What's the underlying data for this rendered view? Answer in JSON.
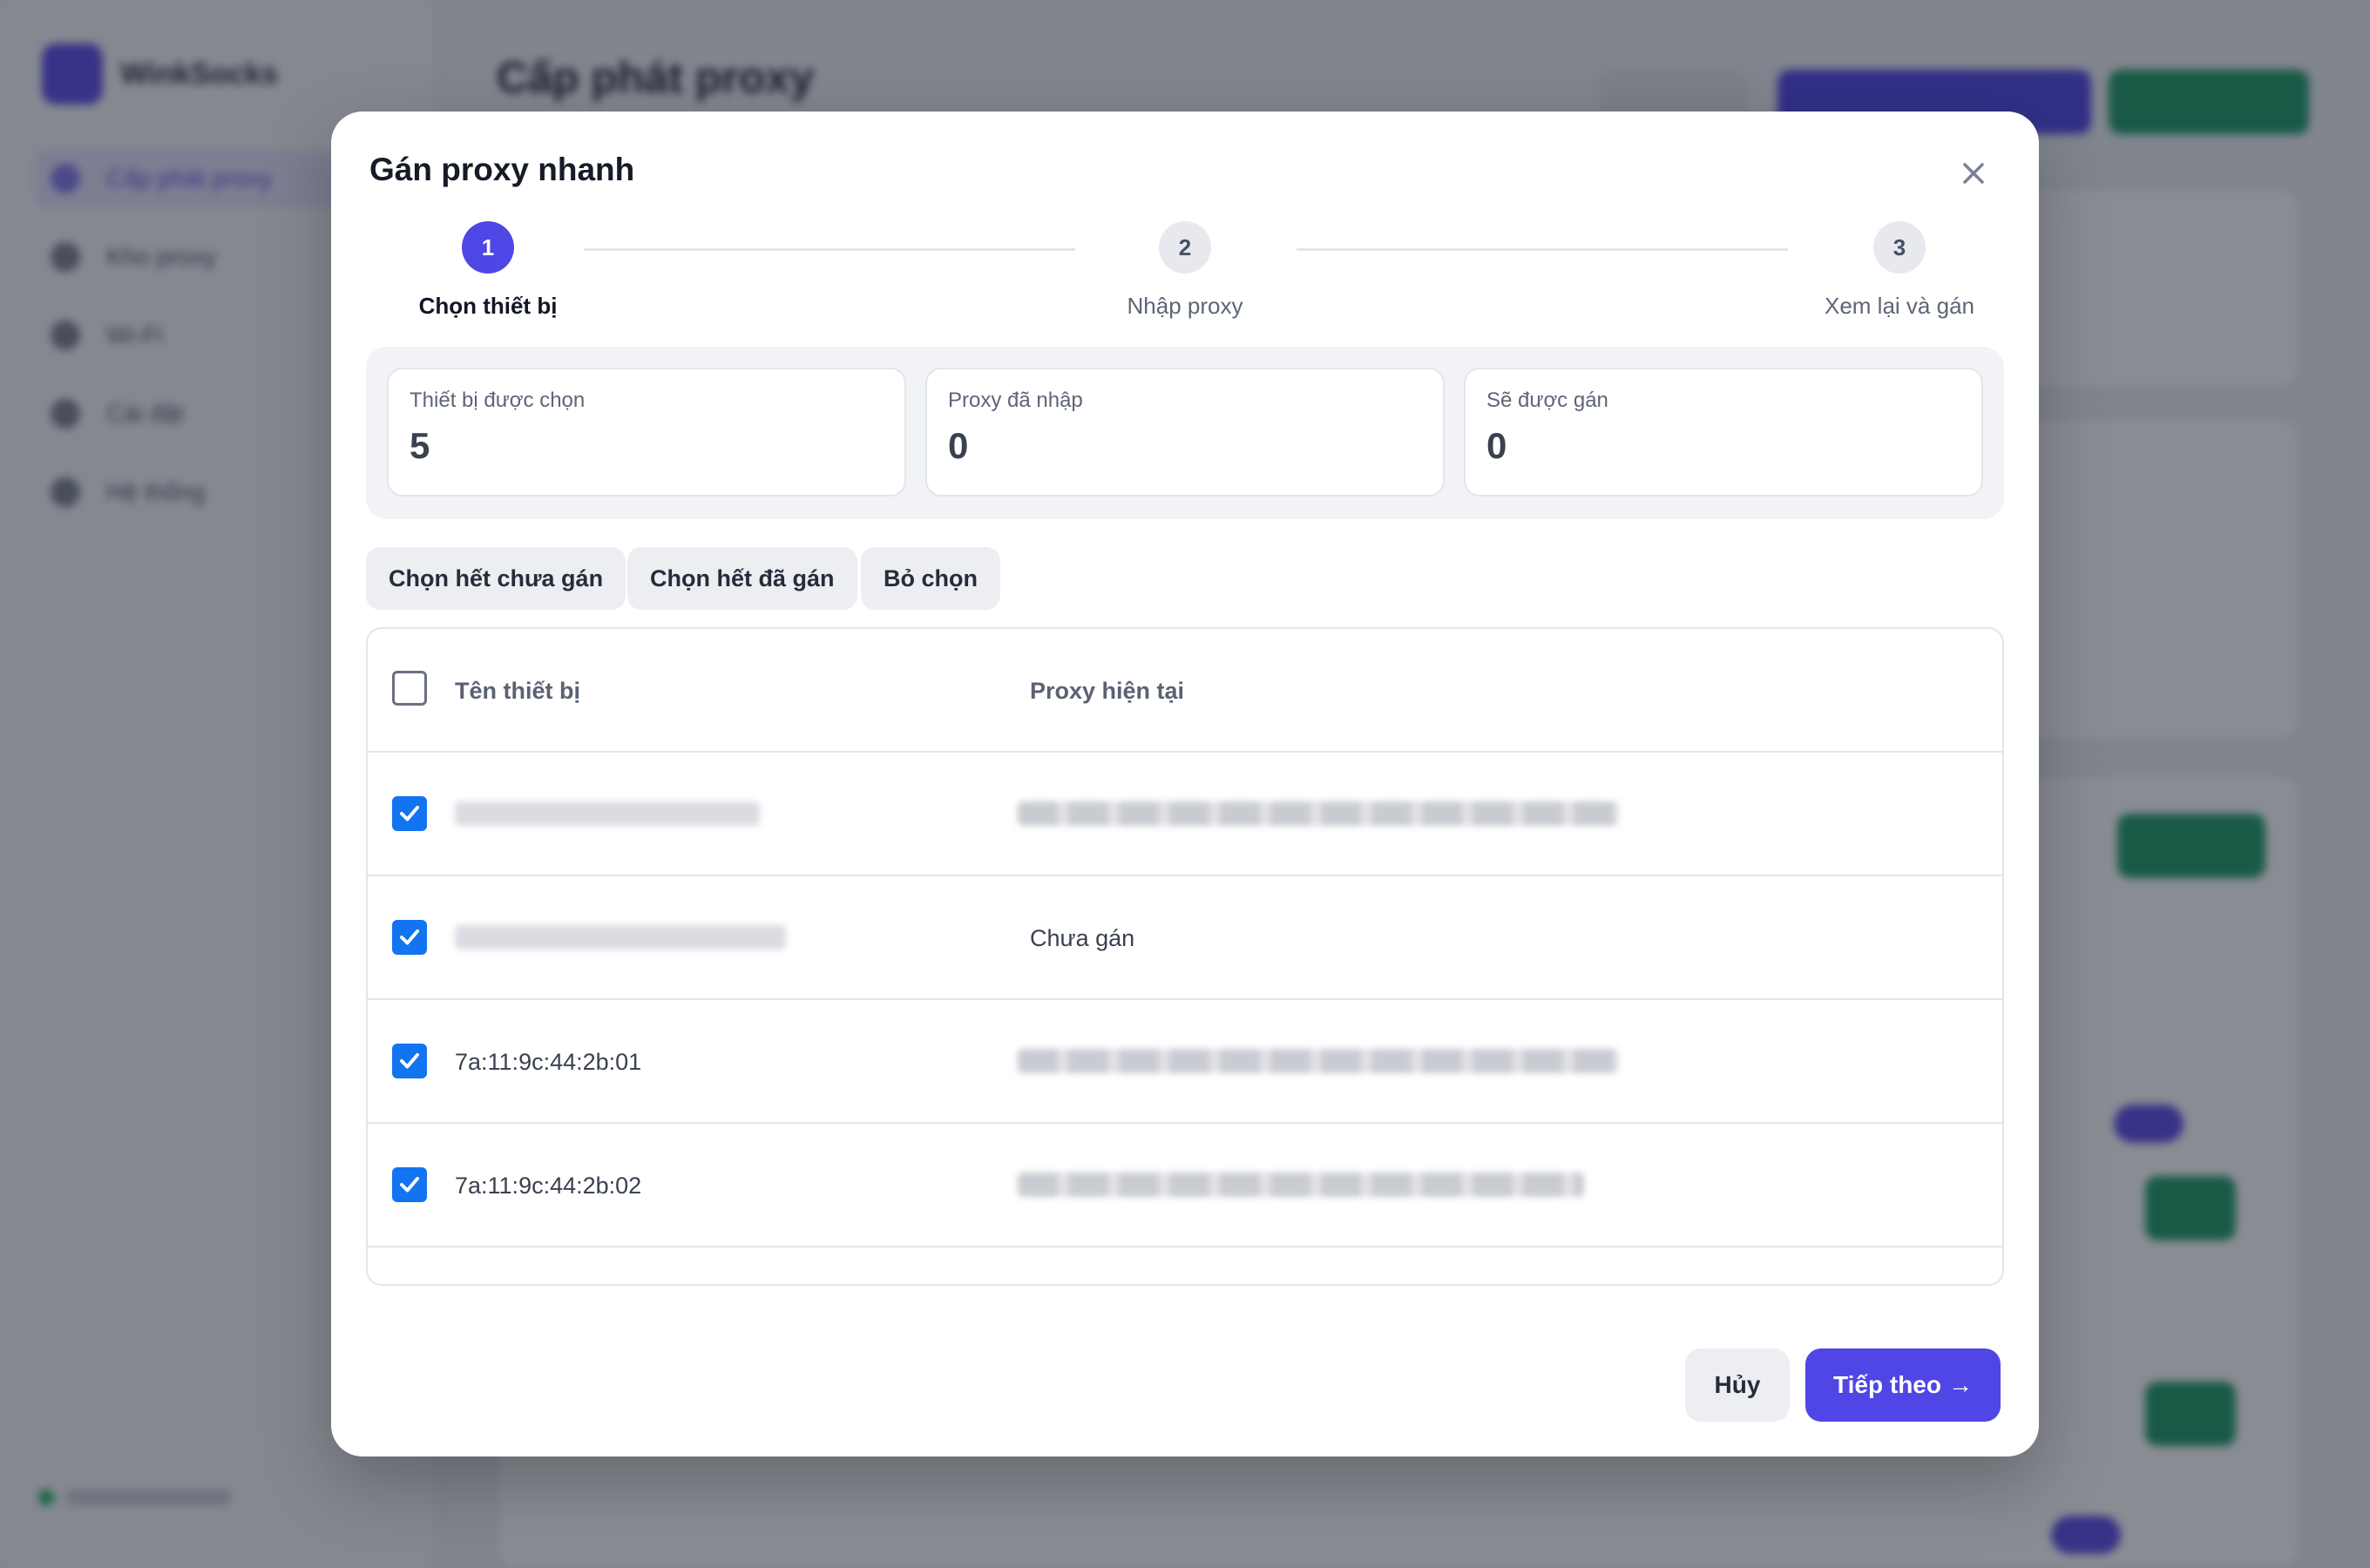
{
  "background": {
    "brand": "WinkSocks",
    "page_title": "Cấp phát proxy",
    "nav": [
      "Cấp phát proxy",
      "Kho proxy",
      "Wi-Fi",
      "Cài đặt",
      "Hệ thống"
    ]
  },
  "modal": {
    "title": "Gán proxy nhanh",
    "steps": [
      {
        "number": "1",
        "label": "Chọn thiết bị",
        "active": true
      },
      {
        "number": "2",
        "label": "Nhập proxy",
        "active": false
      },
      {
        "number": "3",
        "label": "Xem lại và gán",
        "active": false
      }
    ],
    "stats": [
      {
        "label": "Thiết bị được chọn",
        "value": "5"
      },
      {
        "label": "Proxy đã nhập",
        "value": "0"
      },
      {
        "label": "Sẽ được gán",
        "value": "0"
      }
    ],
    "quick_actions": {
      "select_unassigned": "Chọn hết chưa gán",
      "select_assigned": "Chọn hết đã gán",
      "deselect": "Bỏ chọn"
    },
    "table": {
      "headers": {
        "device": "Tên thiết bị",
        "proxy": "Proxy hiện tại"
      },
      "rows": [
        {
          "checked": true,
          "device": "",
          "proxy": ""
        },
        {
          "checked": true,
          "device": "",
          "proxy": "Chưa gán"
        },
        {
          "checked": true,
          "device": "7a:11:9c:44:2b:01",
          "proxy": ""
        },
        {
          "checked": true,
          "device": "7a:11:9c:44:2b:02",
          "proxy": ""
        }
      ]
    },
    "footer": {
      "cancel": "Hủy",
      "next": "Tiếp theo",
      "next_arrow": "→"
    }
  },
  "colors": {
    "primary": "#4f46e5",
    "checkbox": "#1274f0",
    "success_bg": "#1e9a66"
  }
}
